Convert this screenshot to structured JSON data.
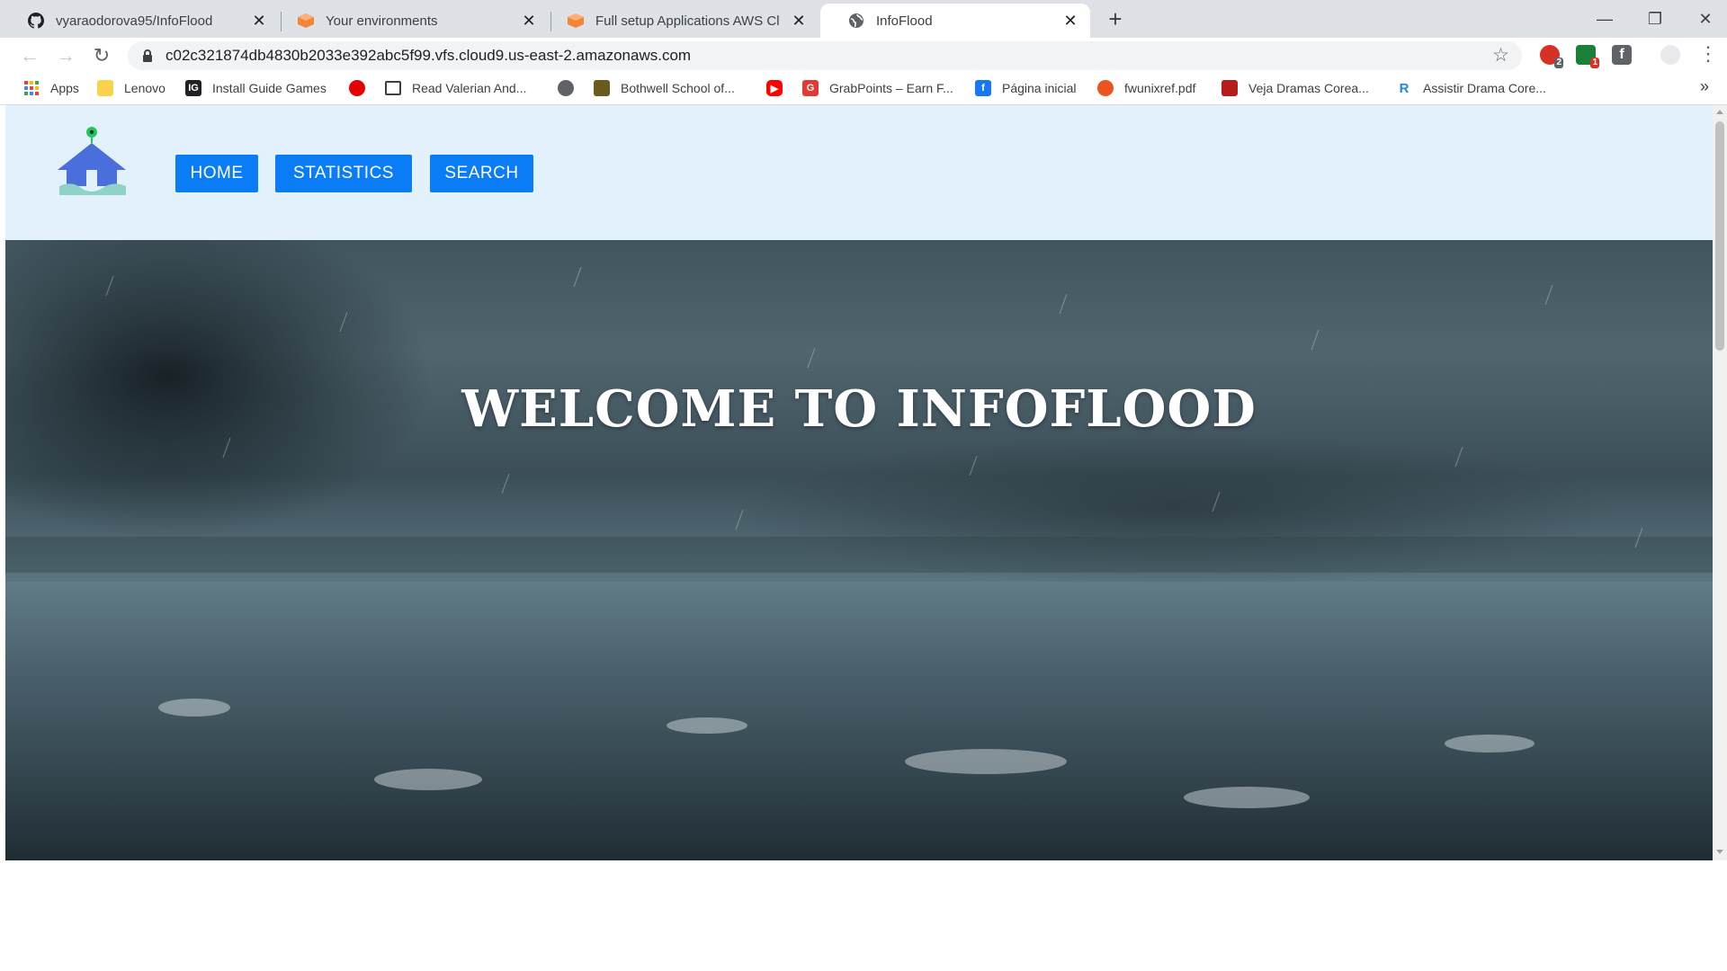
{
  "browser": {
    "tabs": [
      {
        "title": "vyaraodorova95/InfoFlood",
        "icon": "github-icon",
        "active": false
      },
      {
        "title": "Your environments",
        "icon": "aws-cloud9-icon",
        "active": false
      },
      {
        "title": "Full setup Applications   AWS Cl",
        "icon": "aws-cloud9-icon",
        "active": false
      },
      {
        "title": "InfoFlood",
        "icon": "globe-icon",
        "active": true
      }
    ],
    "new_tab_symbol": "+",
    "window_controls": {
      "minimize": "—",
      "maximize": "❐",
      "close": "✕"
    },
    "url": "c02c321874db4830b2033e392abc5f99.vfs.cloud9.us-east-2.amazonaws.com",
    "extensions": [
      {
        "icon": "red-extension-icon",
        "badge": "2",
        "color": "#d93025",
        "badge_color": "#5f6368"
      },
      {
        "icon": "green-extension-icon",
        "badge": "1",
        "color": "#188038",
        "badge_color": "#d93025"
      },
      {
        "icon": "facebook-extension-icon",
        "badge": "",
        "color": "#5f6368",
        "badge_color": ""
      },
      {
        "icon": "profile-icon",
        "badge": "",
        "color": "#bdc1c6",
        "badge_color": ""
      }
    ],
    "bookmarks": [
      {
        "label": "Apps",
        "icon": "apps-grid-icon",
        "color": "#ea4335"
      },
      {
        "label": "Lenovo",
        "icon": "folder-icon",
        "color": "#f9d44a"
      },
      {
        "label": "Install Guide Games",
        "icon": "install-guide-icon",
        "color": "#202124"
      },
      {
        "label": "",
        "icon": "vodafone-icon",
        "color": "#e60000"
      },
      {
        "label": "Read Valerian And...",
        "icon": "book-icon",
        "color": "#3c4043"
      },
      {
        "label": "",
        "icon": "globe-icon",
        "color": "#5f6368"
      },
      {
        "label": "Bothwell School of...",
        "icon": "school-crest-icon",
        "color": "#6b5a1e"
      },
      {
        "label": "",
        "icon": "youtube-icon",
        "color": "#ff0000"
      },
      {
        "label": "GrabPoints – Earn F...",
        "icon": "grabpoints-icon",
        "color": "#e53935"
      },
      {
        "label": "Página inicial",
        "icon": "facebook-icon",
        "color": "#1877f2"
      },
      {
        "label": "fwunixref.pdf",
        "icon": "ubuntu-icon",
        "color": "#e95420"
      },
      {
        "label": "Veja Dramas Corea...",
        "icon": "drama-icon",
        "color": "#b71c1c"
      },
      {
        "label": "Assistir Drama Core...",
        "icon": "r-letter-icon",
        "color": "#1e88e5"
      }
    ],
    "bookmarks_more": "»"
  },
  "site": {
    "nav": [
      {
        "label": "HOME"
      },
      {
        "label": "STATISTICS"
      },
      {
        "label": "SEARCH"
      }
    ],
    "hero_title": "WELCOME TO INFOFLOOD",
    "logo_icon": "house-location-logo-icon"
  },
  "colors": {
    "nav_button": "#0a7cf5",
    "header_bg": "#e3f1fd",
    "tab_strip": "#dee1e6"
  }
}
